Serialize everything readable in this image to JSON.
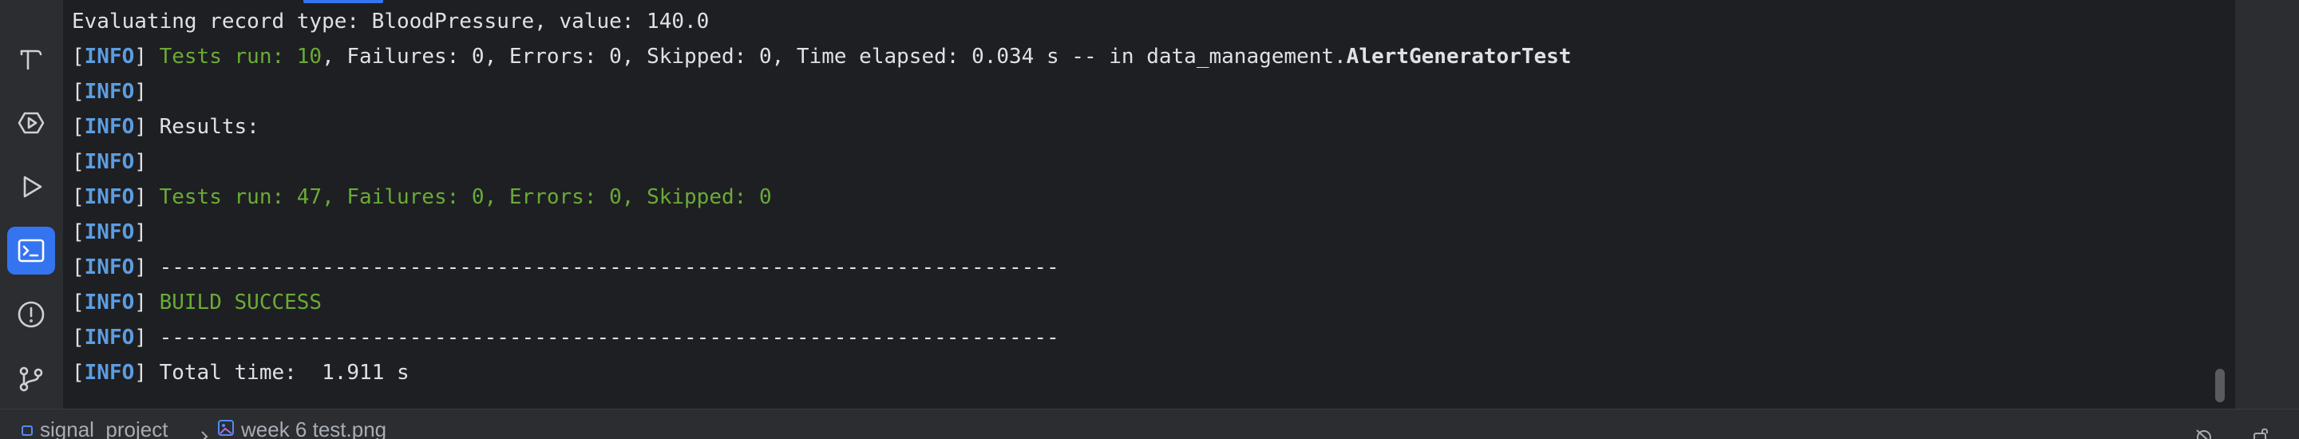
{
  "toolstrip": {
    "items": [
      {
        "name": "build-tool",
        "icon": "hammer-icon",
        "active": false
      },
      {
        "name": "services",
        "icon": "services-icon",
        "active": false
      },
      {
        "name": "run",
        "icon": "run-icon",
        "active": false
      },
      {
        "name": "terminal",
        "icon": "terminal-icon",
        "active": true
      },
      {
        "name": "problems",
        "icon": "problems-icon",
        "active": false
      },
      {
        "name": "git",
        "icon": "git-branch-icon",
        "active": false
      }
    ]
  },
  "console": {
    "lines": [
      {
        "text": "Evaluating record type: BloodPressure, value: 140.0"
      },
      {
        "level": "INFO",
        "green": "Tests run: 10",
        "rest": ", Failures: 0, Errors: 0, Skipped: 0, Time elapsed: 0.034 s -- in data_management.",
        "bold": "AlertGeneratorTest"
      },
      {
        "level": "INFO",
        "rest": ""
      },
      {
        "level": "INFO",
        "rest": " Results:"
      },
      {
        "level": "INFO",
        "rest": ""
      },
      {
        "level": "INFO",
        "green": " Tests run: 47, Failures: 0, Errors: 0, Skipped: 0"
      },
      {
        "level": "INFO",
        "rest": ""
      },
      {
        "level": "INFO",
        "rest": " ------------------------------------------------------------------------"
      },
      {
        "level": "INFO",
        "green": " BUILD SUCCESS"
      },
      {
        "level": "INFO",
        "rest": " ------------------------------------------------------------------------"
      },
      {
        "level": "INFO",
        "rest": " Total time:  1.911 s"
      }
    ]
  },
  "statusbar": {
    "project": "signal_project",
    "file": "week 6 test.png"
  },
  "colors": {
    "info_level": "#5c9de1",
    "success_green": "#6aab36",
    "accent": "#3574f0"
  }
}
